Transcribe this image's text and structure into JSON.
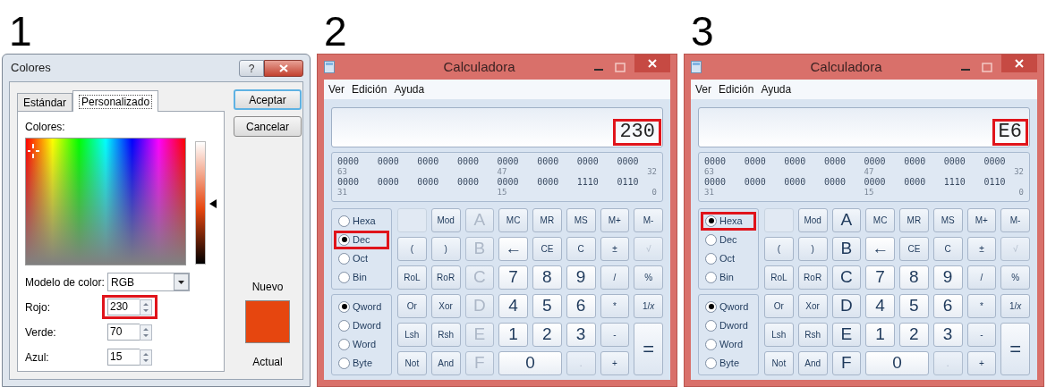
{
  "panels": [
    {
      "kind": "color_dialog",
      "step": "1",
      "title": "Colores",
      "help": "?",
      "tabs": [
        {
          "label": "Estándar",
          "selected": false
        },
        {
          "label": "Personalizado",
          "selected": true
        }
      ],
      "colors_label": "Colores:",
      "luminance": {
        "level": 0.49
      },
      "color_model": {
        "label": "Modelo de color:",
        "value": "RGB"
      },
      "channels": [
        {
          "label": "Rojo:",
          "value": "230",
          "highlighted": true
        },
        {
          "label": "Verde:",
          "value": "70",
          "highlighted": false
        },
        {
          "label": "Azul:",
          "value": "15",
          "highlighted": false
        }
      ],
      "buttons": [
        {
          "label": "Aceptar",
          "default": true
        },
        {
          "label": "Cancelar",
          "default": false
        }
      ],
      "new_label": "Nuevo",
      "swatch": {
        "color": "#e6460f"
      },
      "current_label": "Actual"
    },
    {
      "kind": "calculator",
      "step": "2",
      "title": "Calculadora",
      "menu": [
        "Ver",
        "Edición",
        "Ayuda"
      ],
      "display": {
        "value": "230",
        "highlighted": true
      },
      "bits": [
        {
          "groups": [
            "0000",
            "0000",
            "0000",
            "0000",
            "0000",
            "0000",
            "0000",
            "0000"
          ],
          "marks": [
            "63",
            "47",
            "32"
          ]
        },
        {
          "groups": [
            "0000",
            "0000",
            "0000",
            "0000",
            "0000",
            "0000",
            "1110",
            "0110"
          ],
          "marks": [
            "31",
            "15",
            "0"
          ]
        }
      ],
      "bases": [
        {
          "label": "Hexa",
          "selected": false,
          "highlighted": false
        },
        {
          "label": "Dec",
          "selected": true,
          "highlighted": true
        },
        {
          "label": "Oct",
          "selected": false,
          "highlighted": false
        },
        {
          "label": "Bin",
          "selected": false,
          "highlighted": false
        }
      ],
      "word_sizes": [
        {
          "label": "Qword",
          "selected": true
        },
        {
          "label": "Dword",
          "selected": false
        },
        {
          "label": "Word",
          "selected": false
        },
        {
          "label": "Byte",
          "selected": false
        }
      ],
      "key_rows": [
        [
          {
            "kind": "blank",
            "disabled": true
          },
          {
            "kind": "op",
            "label": "Mod",
            "disabled": false
          },
          {
            "kind": "hex",
            "label": "A",
            "disabled": true
          },
          {
            "kind": "op",
            "label": "MC",
            "disabled": false
          },
          {
            "kind": "op",
            "label": "MR",
            "disabled": false
          },
          {
            "kind": "op",
            "label": "MS",
            "disabled": false
          },
          {
            "kind": "op",
            "label": "M+",
            "disabled": false
          },
          {
            "kind": "op",
            "label": "M-",
            "disabled": false
          }
        ],
        [
          {
            "kind": "op",
            "label": "(",
            "disabled": false
          },
          {
            "kind": "op",
            "label": ")",
            "disabled": false
          },
          {
            "kind": "hex",
            "label": "B",
            "disabled": true
          },
          {
            "kind": "digit",
            "label": "←",
            "disabled": false
          },
          {
            "kind": "op",
            "label": "CE",
            "disabled": false
          },
          {
            "kind": "op",
            "label": "C",
            "disabled": false
          },
          {
            "kind": "op",
            "label": "±",
            "disabled": false
          },
          {
            "kind": "op",
            "label": "√",
            "disabled": true
          }
        ],
        [
          {
            "kind": "op",
            "label": "RoL",
            "disabled": false
          },
          {
            "kind": "op",
            "label": "RoR",
            "disabled": false
          },
          {
            "kind": "hex",
            "label": "C",
            "disabled": true
          },
          {
            "kind": "digit",
            "label": "7",
            "disabled": false
          },
          {
            "kind": "digit",
            "label": "8",
            "disabled": false
          },
          {
            "kind": "digit",
            "label": "9",
            "disabled": false
          },
          {
            "kind": "op",
            "label": "/",
            "disabled": false
          },
          {
            "kind": "op",
            "label": "%",
            "disabled": false
          }
        ],
        [
          {
            "kind": "op",
            "label": "Or",
            "disabled": false
          },
          {
            "kind": "op",
            "label": "Xor",
            "disabled": false
          },
          {
            "kind": "hex",
            "label": "D",
            "disabled": true
          },
          {
            "kind": "digit",
            "label": "4",
            "disabled": false
          },
          {
            "kind": "digit",
            "label": "5",
            "disabled": false
          },
          {
            "kind": "digit",
            "label": "6",
            "disabled": false
          },
          {
            "kind": "op",
            "label": "*",
            "disabled": false
          },
          {
            "kind": "op",
            "label": "1/*x*",
            "disabled": false
          }
        ],
        [
          {
            "kind": "op",
            "label": "Lsh",
            "disabled": false
          },
          {
            "kind": "op",
            "label": "Rsh",
            "disabled": false
          },
          {
            "kind": "hex",
            "label": "E",
            "disabled": true
          },
          {
            "kind": "digit",
            "label": "1",
            "disabled": false
          },
          {
            "kind": "digit",
            "label": "2",
            "disabled": false
          },
          {
            "kind": "digit",
            "label": "3",
            "disabled": false
          },
          {
            "kind": "op",
            "label": "-",
            "disabled": false
          },
          {
            "kind": "equals",
            "label": "=",
            "disabled": false
          }
        ],
        [
          {
            "kind": "op",
            "label": "Not",
            "disabled": false
          },
          {
            "kind": "op",
            "label": "And",
            "disabled": false
          },
          {
            "kind": "hex",
            "label": "F",
            "disabled": true
          },
          {
            "kind": "zero",
            "label": "0",
            "disabled": false
          },
          {
            "kind": "op",
            "label": ".",
            "disabled": true
          },
          {
            "kind": "op",
            "label": "+",
            "disabled": false
          }
        ]
      ]
    },
    {
      "kind": "calculator",
      "step": "3",
      "title": "Calculadora",
      "menu": [
        "Ver",
        "Edición",
        "Ayuda"
      ],
      "display": {
        "value": "E6",
        "highlighted": true
      },
      "bits": [
        {
          "groups": [
            "0000",
            "0000",
            "0000",
            "0000",
            "0000",
            "0000",
            "0000",
            "0000"
          ],
          "marks": [
            "63",
            "47",
            "32"
          ]
        },
        {
          "groups": [
            "0000",
            "0000",
            "0000",
            "0000",
            "0000",
            "0000",
            "1110",
            "0110"
          ],
          "marks": [
            "31",
            "15",
            "0"
          ]
        }
      ],
      "bases": [
        {
          "label": "Hexa",
          "selected": true,
          "highlighted": true
        },
        {
          "label": "Dec",
          "selected": false,
          "highlighted": false
        },
        {
          "label": "Oct",
          "selected": false,
          "highlighted": false
        },
        {
          "label": "Bin",
          "selected": false,
          "highlighted": false
        }
      ],
      "word_sizes": [
        {
          "label": "Qword",
          "selected": true
        },
        {
          "label": "Dword",
          "selected": false
        },
        {
          "label": "Word",
          "selected": false
        },
        {
          "label": "Byte",
          "selected": false
        }
      ],
      "key_rows": [
        [
          {
            "kind": "blank",
            "disabled": true
          },
          {
            "kind": "op",
            "label": "Mod",
            "disabled": false
          },
          {
            "kind": "hex",
            "label": "A",
            "disabled": false
          },
          {
            "kind": "op",
            "label": "MC",
            "disabled": false
          },
          {
            "kind": "op",
            "label": "MR",
            "disabled": false
          },
          {
            "kind": "op",
            "label": "MS",
            "disabled": false
          },
          {
            "kind": "op",
            "label": "M+",
            "disabled": false
          },
          {
            "kind": "op",
            "label": "M-",
            "disabled": false
          }
        ],
        [
          {
            "kind": "op",
            "label": "(",
            "disabled": false
          },
          {
            "kind": "op",
            "label": ")",
            "disabled": false
          },
          {
            "kind": "hex",
            "label": "B",
            "disabled": false
          },
          {
            "kind": "digit",
            "label": "←",
            "disabled": false
          },
          {
            "kind": "op",
            "label": "CE",
            "disabled": false
          },
          {
            "kind": "op",
            "label": "C",
            "disabled": false
          },
          {
            "kind": "op",
            "label": "±",
            "disabled": false
          },
          {
            "kind": "op",
            "label": "√",
            "disabled": true
          }
        ],
        [
          {
            "kind": "op",
            "label": "RoL",
            "disabled": false
          },
          {
            "kind": "op",
            "label": "RoR",
            "disabled": false
          },
          {
            "kind": "hex",
            "label": "C",
            "disabled": false
          },
          {
            "kind": "digit",
            "label": "7",
            "disabled": false
          },
          {
            "kind": "digit",
            "label": "8",
            "disabled": false
          },
          {
            "kind": "digit",
            "label": "9",
            "disabled": false
          },
          {
            "kind": "op",
            "label": "/",
            "disabled": false
          },
          {
            "kind": "op",
            "label": "%",
            "disabled": false
          }
        ],
        [
          {
            "kind": "op",
            "label": "Or",
            "disabled": false
          },
          {
            "kind": "op",
            "label": "Xor",
            "disabled": false
          },
          {
            "kind": "hex",
            "label": "D",
            "disabled": false
          },
          {
            "kind": "digit",
            "label": "4",
            "disabled": false
          },
          {
            "kind": "digit",
            "label": "5",
            "disabled": false
          },
          {
            "kind": "digit",
            "label": "6",
            "disabled": false
          },
          {
            "kind": "op",
            "label": "*",
            "disabled": false
          },
          {
            "kind": "op",
            "label": "1/*x*",
            "disabled": false
          }
        ],
        [
          {
            "kind": "op",
            "label": "Lsh",
            "disabled": false
          },
          {
            "kind": "op",
            "label": "Rsh",
            "disabled": false
          },
          {
            "kind": "hex",
            "label": "E",
            "disabled": false
          },
          {
            "kind": "digit",
            "label": "1",
            "disabled": false
          },
          {
            "kind": "digit",
            "label": "2",
            "disabled": false
          },
          {
            "kind": "digit",
            "label": "3",
            "disabled": false
          },
          {
            "kind": "op",
            "label": "-",
            "disabled": false
          },
          {
            "kind": "equals",
            "label": "=",
            "disabled": false
          }
        ],
        [
          {
            "kind": "op",
            "label": "Not",
            "disabled": false
          },
          {
            "kind": "op",
            "label": "And",
            "disabled": false
          },
          {
            "kind": "hex",
            "label": "F",
            "disabled": false
          },
          {
            "kind": "zero",
            "label": "0",
            "disabled": false
          },
          {
            "kind": "op",
            "label": ".",
            "disabled": true
          },
          {
            "kind": "op",
            "label": "+",
            "disabled": false
          }
        ]
      ]
    }
  ]
}
